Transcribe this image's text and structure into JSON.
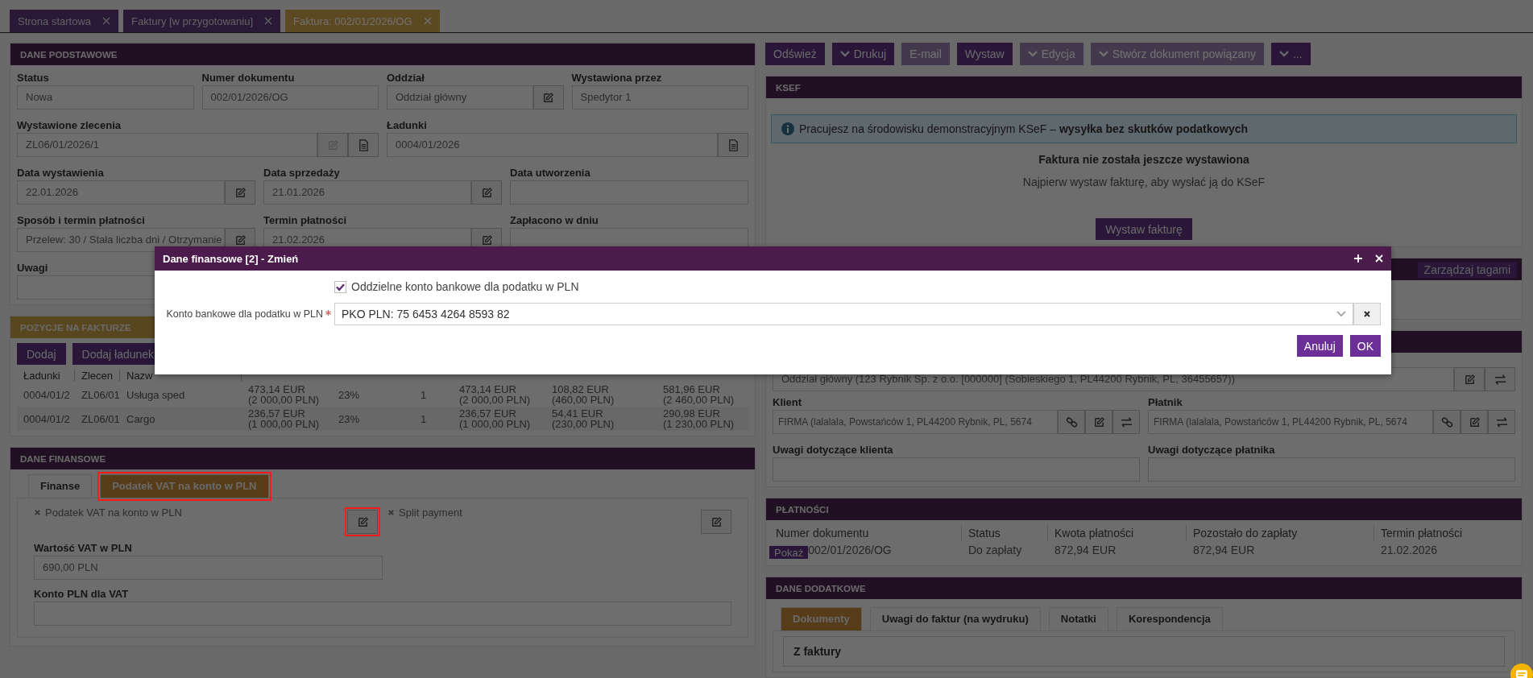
{
  "tabs": [
    {
      "label": "Strona startowa",
      "selected": false
    },
    {
      "label": "Faktury [w przygotowaniu]",
      "selected": false
    },
    {
      "label": "Faktura: 002/01/2026/OG",
      "selected": true
    }
  ],
  "basic": {
    "title": "DANE PODSTAWOWE",
    "rows": [
      {
        "fields": [
          {
            "label": "Status",
            "value": "Nowa"
          },
          {
            "label": "Numer dokumentu",
            "value": "002/01/2026/OG"
          },
          {
            "label": "Oddział",
            "value": "Oddział główny",
            "buttons": [
              {
                "kind": "edit",
                "disabled": false
              }
            ]
          },
          {
            "label": "Wystawiona przez",
            "value": "Spedytor 1"
          }
        ]
      },
      {
        "fields": [
          {
            "label": "Wystawione zlecenia",
            "value": "ZL06/01/2026/1",
            "buttons": [
              {
                "kind": "edit",
                "disabled": true
              },
              {
                "kind": "document",
                "disabled": false
              }
            ]
          },
          {
            "label": "Ładunki",
            "value": "0004/01/2026",
            "buttons": [
              {
                "kind": "document",
                "disabled": false
              }
            ]
          }
        ]
      },
      {
        "fields": [
          {
            "label": "Data wystawienia",
            "value": "22.01.2026",
            "buttons": [
              {
                "kind": "edit",
                "disabled": false
              }
            ]
          },
          {
            "label": "Data sprzedaży",
            "value": "21.01.2026",
            "buttons": [
              {
                "kind": "edit",
                "disabled": false
              }
            ]
          },
          {
            "label": "Data utworzenia"
          }
        ]
      },
      {
        "fields": [
          {
            "label": "Sposób i termin płatności",
            "value": "Przelew: 30 / Stała liczba dni / Otrzymanie",
            "buttons": [
              {
                "kind": "edit",
                "disabled": false
              }
            ]
          },
          {
            "label": "Termin płatności",
            "value": "21.02.2026",
            "buttons": [
              {
                "kind": "edit",
                "disabled": false
              }
            ]
          },
          {
            "label": "Zapłacono w dniu"
          }
        ]
      },
      {
        "fields": [
          {
            "label": "Uwagi"
          }
        ]
      }
    ]
  },
  "positions": {
    "title": "POZYCJE NA FAKTURZE",
    "buttons": [
      "Dodaj",
      "Dodaj ładunek"
    ],
    "columns": [
      "Ładunki",
      "Zlecen",
      "Nazw"
    ],
    "rows": [
      {
        "cells": [
          "0004/01/2",
          "ZL06/01",
          "Usługa sped",
          "473,14 EUR\n(2 000,00 PLN)",
          "23%",
          "1",
          "473,14 EUR\n(2 000,00 PLN)",
          "108,82 EUR\n(460,00 PLN)",
          "581,96 EUR\n(2 460,00 PLN)"
        ]
      },
      {
        "cells": [
          "0004/01/2",
          "ZL06/01",
          "Cargo",
          "236,57 EUR\n(1 000,00 PLN)",
          "23%",
          "1",
          "236,57 EUR\n(1 000,00 PLN)",
          "54,41 EUR\n(230,00 PLN)",
          "290,98 EUR\n(1 230,00 PLN)"
        ]
      }
    ]
  },
  "finance": {
    "title": "DANE FINANSOWE",
    "tabs": [
      {
        "label": "Finanse",
        "selected": false,
        "highlighted": false
      },
      {
        "label": "Podatek VAT na konto w PLN",
        "selected": true,
        "highlighted": true
      }
    ],
    "flags": [
      {
        "label": "Podatek VAT na konto w PLN",
        "checked": false,
        "highlighted": true
      },
      {
        "label": "Split payment",
        "checked": false,
        "highlighted": false
      }
    ],
    "fields": [
      {
        "label": "Wartość VAT w PLN",
        "value": "690,00 PLN"
      },
      {
        "label": "Konto PLN dla VAT"
      }
    ]
  },
  "toolbar": [
    {
      "label": "Odśwież",
      "caret": false,
      "disabled": false
    },
    {
      "label": "Drukuj",
      "caret": true,
      "disabled": false
    },
    {
      "label": "E-mail",
      "caret": false,
      "disabled": true
    },
    {
      "label": "Wystaw",
      "caret": false,
      "disabled": false
    },
    {
      "label": "Edycja",
      "caret": true,
      "disabled": true
    },
    {
      "label": "Stwórz dokument powiązany",
      "caret": true,
      "disabled": true
    },
    {
      "label": "...",
      "caret": true,
      "disabled": false
    }
  ],
  "ksef": {
    "title": "KSEF",
    "notice": "Pracujesz na środowisku demonstracyjnym KSeF – **wysyłka bez skutków podatkowych**",
    "heading": "Faktura nie została jeszcze wystawiona",
    "text": "Najpierw wystaw fakturę, aby wysłać ją do KSeF",
    "button": "Wystaw fakturę"
  },
  "tags": {
    "button": "Zarządzaj tagami"
  },
  "parties": {
    "branch": {
      "value": "Oddział główny (123 Rybnik Sp. z o.o. [000000] (Sobieskiego 1, PL44200 Rybnik, PL, 36455657))",
      "buttons": [
        {
          "kind": "edit",
          "disabled": false
        },
        {
          "kind": "swap",
          "disabled": false
        }
      ]
    },
    "fields": [
      {
        "label": "Klient",
        "value": "FIRMA (lalalala, Powstańców 1, PL44200 Rybnik, PL, 5674",
        "buttons": [
          {
            "kind": "link",
            "disabled": false
          },
          {
            "kind": "edit",
            "disabled": false
          },
          {
            "kind": "swap",
            "disabled": false
          }
        ]
      },
      {
        "label": "Płatnik",
        "value": "FIRMA (lalalala, Powstańców 1, PL44200 Rybnik, PL, 5674",
        "buttons": [
          {
            "kind": "link",
            "disabled": false
          },
          {
            "kind": "edit",
            "disabled": false
          },
          {
            "kind": "swap",
            "disabled": false
          }
        ]
      },
      {
        "label": "Uwagi dotyczące klienta"
      },
      {
        "label": "Uwagi dotyczące płatnika"
      }
    ]
  },
  "payments": {
    "title": "PŁATNOŚCI",
    "columns": [
      "Numer dokumentu",
      "Status",
      "Kwota płatności",
      "Pozostało do zapłaty",
      "Termin płatności"
    ],
    "rows": [
      {
        "button": "Pokaż",
        "cells": [
          "002/01/2026/OG",
          "Do zapłaty",
          "872,94 EUR",
          "872,94 EUR",
          "21.02.2026"
        ]
      }
    ]
  },
  "extra": {
    "title": "DANE DODATKOWE",
    "tabs": [
      {
        "label": "Dokumenty",
        "selected": true
      },
      {
        "label": "Uwagi do faktur (na wydruku)",
        "selected": false
      },
      {
        "label": "Notatki",
        "selected": false
      },
      {
        "label": "Korespondencja",
        "selected": false
      }
    ],
    "subpanel": "Z faktury"
  },
  "modal": {
    "title": "Dane finansowe [2] - Zmień",
    "checkbox": {
      "label": "Oddzielne konto bankowe dla podatku w PLN",
      "checked": true
    },
    "field": {
      "label": "Konto bankowe dla podatku w PLN",
      "required": true,
      "value": "PKO PLN: 75 6453 4264 8593 82"
    },
    "buttons": [
      "Anuluj",
      "OK"
    ]
  }
}
